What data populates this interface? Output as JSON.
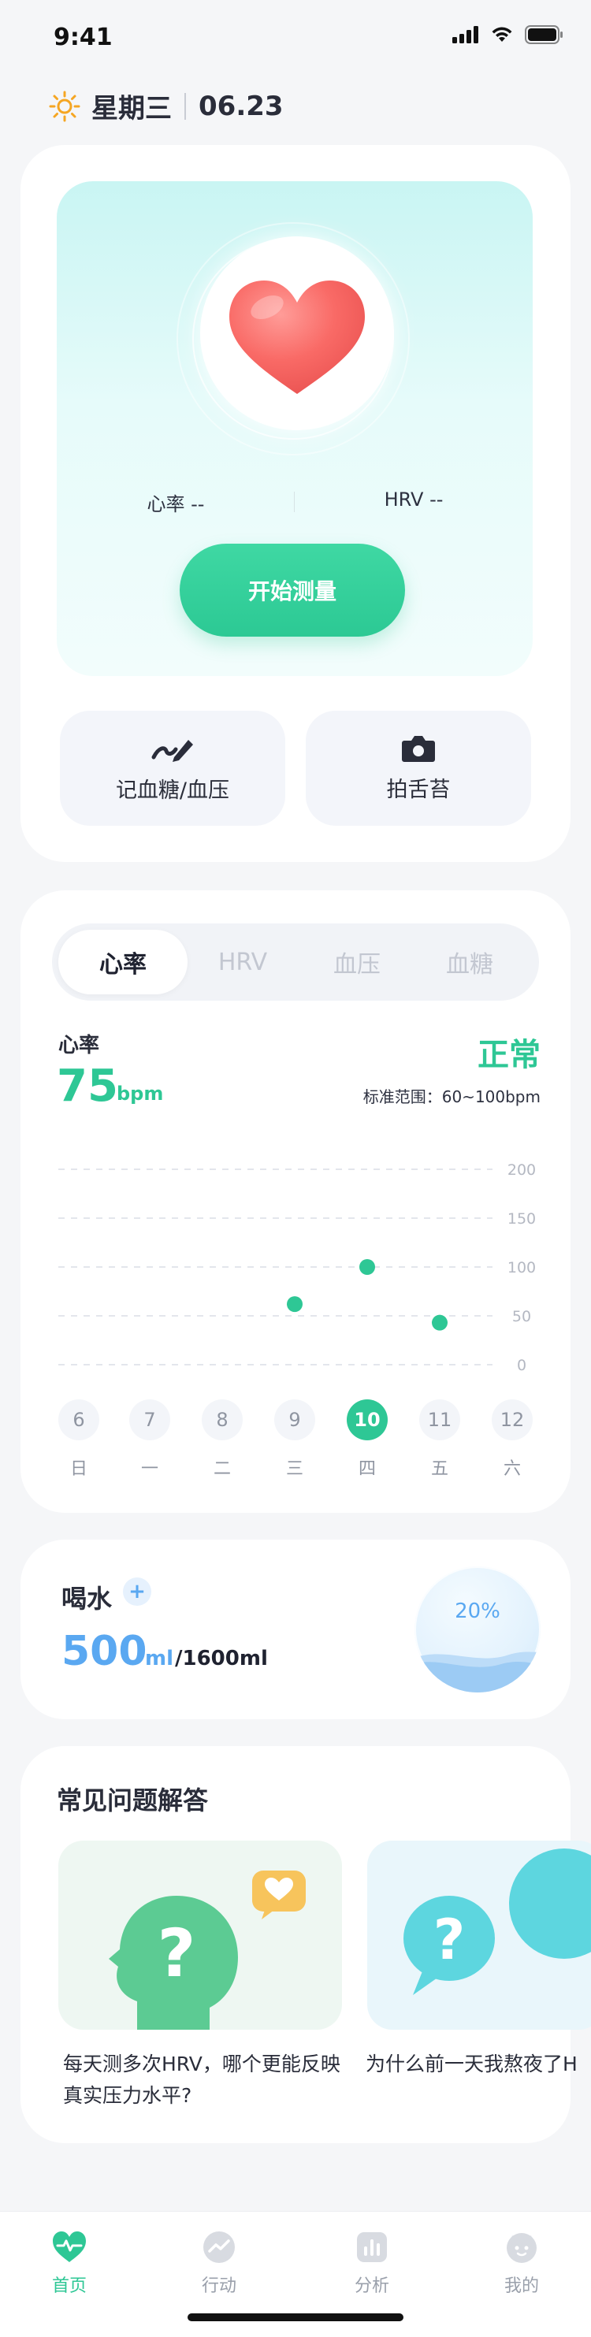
{
  "status_bar": {
    "time": "9:41"
  },
  "header": {
    "weekday": "星期三",
    "date": "06.23"
  },
  "measure": {
    "heart_rate_label": "心率 --",
    "hrv_label": "HRV --",
    "start_button": "开始测量"
  },
  "quick_actions": [
    {
      "label": "记血糖/血压",
      "icon": "pen-edit-icon"
    },
    {
      "label": "拍舌苔",
      "icon": "camera-icon"
    }
  ],
  "metrics_tabs": [
    "心率",
    "HRV",
    "血压",
    "血糖"
  ],
  "heart_rate": {
    "title": "心率",
    "value": "75",
    "unit": "bpm",
    "status": "正常",
    "range": "标准范围：60~100bpm"
  },
  "chart_data": {
    "type": "scatter",
    "title": "",
    "xlabel": "",
    "ylabel": "",
    "y_ticks": [
      "200",
      "150",
      "100",
      "50",
      "0"
    ],
    "ylim": [
      0,
      200
    ],
    "days": [
      {
        "date": "6",
        "weekday": "日"
      },
      {
        "date": "7",
        "weekday": "一"
      },
      {
        "date": "8",
        "weekday": "二"
      },
      {
        "date": "9",
        "weekday": "三"
      },
      {
        "date": "10",
        "weekday": "四"
      },
      {
        "date": "11",
        "weekday": "五"
      },
      {
        "date": "12",
        "weekday": "六"
      }
    ],
    "selected_day": "10",
    "points": [
      {
        "x": "9",
        "y": 62
      },
      {
        "x": "10",
        "y": 100
      },
      {
        "x": "11",
        "y": 43
      }
    ],
    "grid": true,
    "colors": {
      "point": "#2ec795",
      "selected": "#2ec795"
    }
  },
  "water": {
    "title": "喝水",
    "plus": "+",
    "amount": "500",
    "unit": "ml",
    "goal": "/1600ml",
    "percent": "20%",
    "fill_fraction": 0.2
  },
  "faq": {
    "title": "常见问题解答",
    "items": [
      {
        "text": "每天测多次HRV，哪个更能反映真实压力水平?"
      },
      {
        "text": "为什么前一天我熬夜了HRV反而更高，睡够了反而降低"
      }
    ]
  },
  "tabbar": [
    {
      "label": "首页",
      "icon": "heart-pulse-icon",
      "active": true
    },
    {
      "label": "行动",
      "icon": "trend-icon",
      "active": false
    },
    {
      "label": "分析",
      "icon": "bar-chart-icon",
      "active": false
    },
    {
      "label": "我的",
      "icon": "profile-icon",
      "active": false
    }
  ],
  "colors": {
    "accent": "#2ec795",
    "water": "#5aa8f1"
  }
}
